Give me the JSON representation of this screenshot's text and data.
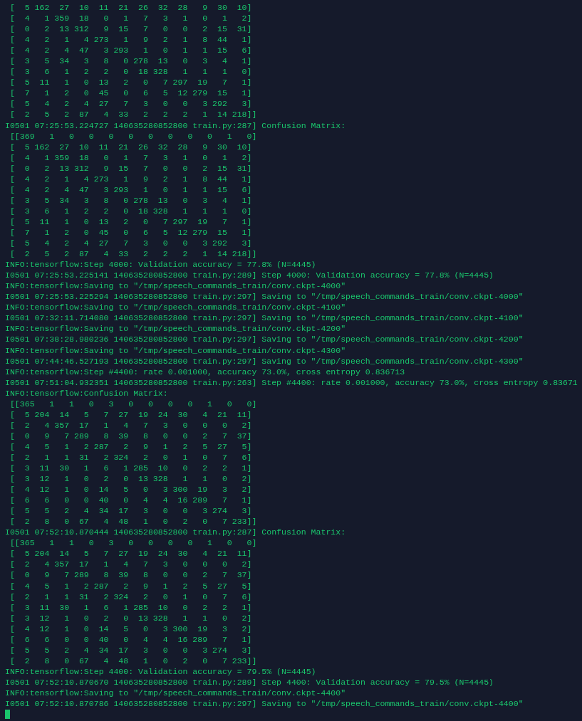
{
  "terminal": {
    "lines": [
      {
        "kind": "matrix",
        "text": "[  5 162  27  10  11  21  26  32  28   9  30  10]"
      },
      {
        "kind": "matrix",
        "text": "[  4   1 359  18   0   1   7   3   1   0   1   2]"
      },
      {
        "kind": "matrix",
        "text": "[  0   2  13 312   9  15   7   0   0   2  15  31]"
      },
      {
        "kind": "matrix",
        "text": "[  4   2   1   4 273   1   9   2   1   8  44   1]"
      },
      {
        "kind": "matrix",
        "text": "[  4   2   4  47   3 293   1   0   1   1  15   6]"
      },
      {
        "kind": "matrix",
        "text": "[  3   5  34   3   8   0 278  13   0   3   4   1]"
      },
      {
        "kind": "matrix",
        "text": "[  3   6   1   2   2   0  18 328   1   1   1   0]"
      },
      {
        "kind": "matrix",
        "text": "[  5  11   1   0  13   2   0   7 297  19   7   1]"
      },
      {
        "kind": "matrix",
        "text": "[  7   1   2   0  45   0   6   5  12 279  15   1]"
      },
      {
        "kind": "matrix",
        "text": "[  5   4   2   4  27   7   3   0   0   3 292   3]"
      },
      {
        "kind": "matrix",
        "text": "[  2   5   2  87   4  33   2   2   2   1  14 218]]"
      },
      {
        "kind": "log",
        "text": "I0501 07:25:53.224727 140635280852800 train.py:287] Confusion Matrix:"
      },
      {
        "kind": "matrix",
        "text": "[[369   1   0   0   0   0   0   0   0   0   1   0]"
      },
      {
        "kind": "matrix",
        "text": "[  5 162  27  10  11  21  26  32  28   9  30  10]"
      },
      {
        "kind": "matrix",
        "text": "[  4   1 359  18   0   1   7   3   1   0   1   2]"
      },
      {
        "kind": "matrix",
        "text": "[  0   2  13 312   9  15   7   0   0   2  15  31]"
      },
      {
        "kind": "matrix",
        "text": "[  4   2   1   4 273   1   9   2   1   8  44   1]"
      },
      {
        "kind": "matrix",
        "text": "[  4   2   4  47   3 293   1   0   1   1  15   6]"
      },
      {
        "kind": "matrix",
        "text": "[  3   5  34   3   8   0 278  13   0   3   4   1]"
      },
      {
        "kind": "matrix",
        "text": "[  3   6   1   2   2   0  18 328   1   1   1   0]"
      },
      {
        "kind": "matrix",
        "text": "[  5  11   1   0  13   2   0   7 297  19   7   1]"
      },
      {
        "kind": "matrix",
        "text": "[  7   1   2   0  45   0   6   5  12 279  15   1]"
      },
      {
        "kind": "matrix",
        "text": "[  5   4   2   4  27   7   3   0   0   3 292   3]"
      },
      {
        "kind": "matrix",
        "text": "[  2   5   2  87   4  33   2   2   2   1  14 218]]"
      },
      {
        "kind": "log",
        "text": "INFO:tensorflow:Step 4000: Validation accuracy = 77.8% (N=4445)"
      },
      {
        "kind": "log",
        "text": "I0501 07:25:53.225141 140635280852800 train.py:289] Step 4000: Validation accuracy = 77.8% (N=4445)"
      },
      {
        "kind": "log",
        "text": "INFO:tensorflow:Saving to \"/tmp/speech_commands_train/conv.ckpt-4000\""
      },
      {
        "kind": "log",
        "text": "I0501 07:25:53.225294 140635280852800 train.py:297] Saving to \"/tmp/speech_commands_train/conv.ckpt-4000\""
      },
      {
        "kind": "log",
        "text": "INFO:tensorflow:Saving to \"/tmp/speech_commands_train/conv.ckpt-4100\""
      },
      {
        "kind": "log",
        "text": "I0501 07:32:11.714080 140635280852800 train.py:297] Saving to \"/tmp/speech_commands_train/conv.ckpt-4100\""
      },
      {
        "kind": "log",
        "text": "INFO:tensorflow:Saving to \"/tmp/speech_commands_train/conv.ckpt-4200\""
      },
      {
        "kind": "log",
        "text": "I0501 07:38:28.980236 140635280852800 train.py:297] Saving to \"/tmp/speech_commands_train/conv.ckpt-4200\""
      },
      {
        "kind": "log",
        "text": "INFO:tensorflow:Saving to \"/tmp/speech_commands_train/conv.ckpt-4300\""
      },
      {
        "kind": "log",
        "text": "I0501 07:44:46.527193 140635280852800 train.py:297] Saving to \"/tmp/speech_commands_train/conv.ckpt-4300\""
      },
      {
        "kind": "log",
        "text": "INFO:tensorflow:Step #4400: rate 0.001000, accuracy 73.0%, cross entropy 0.836713"
      },
      {
        "kind": "log",
        "text": "I0501 07:51:04.932351 140635280852800 train.py:263] Step #4400: rate 0.001000, accuracy 73.0%, cross entropy 0.83671"
      },
      {
        "kind": "log",
        "text": "INFO:tensorflow:Confusion Matrix:"
      },
      {
        "kind": "matrix",
        "text": "[[365   1   1   0   3   0   0   0   0   1   0   0]"
      },
      {
        "kind": "matrix",
        "text": "[  5 204  14   5   7  27  19  24  30   4  21  11]"
      },
      {
        "kind": "matrix",
        "text": "[  2   4 357  17   1   4   7   3   0   0   0   2]"
      },
      {
        "kind": "matrix",
        "text": "[  0   9   7 289   8  39   8   0   0   2   7  37]"
      },
      {
        "kind": "matrix",
        "text": "[  4   5   1   2 287   2   9   1   2   5  27   5]"
      },
      {
        "kind": "matrix",
        "text": "[  2   1   1  31   2 324   2   0   1   0   7   6]"
      },
      {
        "kind": "matrix",
        "text": "[  3  11  30   1   6   1 285  10   0   2   2   1]"
      },
      {
        "kind": "matrix",
        "text": "[  3  12   1   0   2   0  13 328   1   1   0   2]"
      },
      {
        "kind": "matrix",
        "text": "[  4  12   1   0  14   5   0   3 300  19   3   2]"
      },
      {
        "kind": "matrix",
        "text": "[  6   6   0   0  40   0   4   4  16 289   7   1]"
      },
      {
        "kind": "matrix",
        "text": "[  5   5   2   4  34  17   3   0   0   3 274   3]"
      },
      {
        "kind": "matrix",
        "text": "[  2   8   0  67   4  48   1   0   2   0   7 233]]"
      },
      {
        "kind": "log",
        "text": "I0501 07:52:10.870444 140635280852800 train.py:287] Confusion Matrix:"
      },
      {
        "kind": "matrix",
        "text": "[[365   1   1   0   3   0   0   0   0   1   0   0]"
      },
      {
        "kind": "matrix",
        "text": "[  5 204  14   5   7  27  19  24  30   4  21  11]"
      },
      {
        "kind": "matrix",
        "text": "[  2   4 357  17   1   4   7   3   0   0   0   2]"
      },
      {
        "kind": "matrix",
        "text": "[  0   9   7 289   8  39   8   0   0   2   7  37]"
      },
      {
        "kind": "matrix",
        "text": "[  4   5   1   2 287   2   9   1   2   5  27   5]"
      },
      {
        "kind": "matrix",
        "text": "[  2   1   1  31   2 324   2   0   1   0   7   6]"
      },
      {
        "kind": "matrix",
        "text": "[  3  11  30   1   6   1 285  10   0   2   2   1]"
      },
      {
        "kind": "matrix",
        "text": "[  3  12   1   0   2   0  13 328   1   1   0   2]"
      },
      {
        "kind": "matrix",
        "text": "[  4  12   1   0  14   5   0   3 300  19   3   2]"
      },
      {
        "kind": "matrix",
        "text": "[  6   6   0   0  40   0   4   4  16 289   7   1]"
      },
      {
        "kind": "matrix",
        "text": "[  5   5   2   4  34  17   3   0   0   3 274   3]"
      },
      {
        "kind": "matrix",
        "text": "[  2   8   0  67   4  48   1   0   2   0   7 233]]"
      },
      {
        "kind": "log",
        "text": "INFO:tensorflow:Step 4400: Validation accuracy = 79.5% (N=4445)"
      },
      {
        "kind": "log",
        "text": "I0501 07:52:10.870670 140635280852800 train.py:289] Step 4400: Validation accuracy = 79.5% (N=4445)"
      },
      {
        "kind": "log",
        "text": "INFO:tensorflow:Saving to \"/tmp/speech_commands_train/conv.ckpt-4400\""
      },
      {
        "kind": "log",
        "text": "I0501 07:52:10.870786 140635280852800 train.py:297] Saving to \"/tmp/speech_commands_train/conv.ckpt-4400\""
      }
    ],
    "cursor": {
      "visible": true
    }
  }
}
